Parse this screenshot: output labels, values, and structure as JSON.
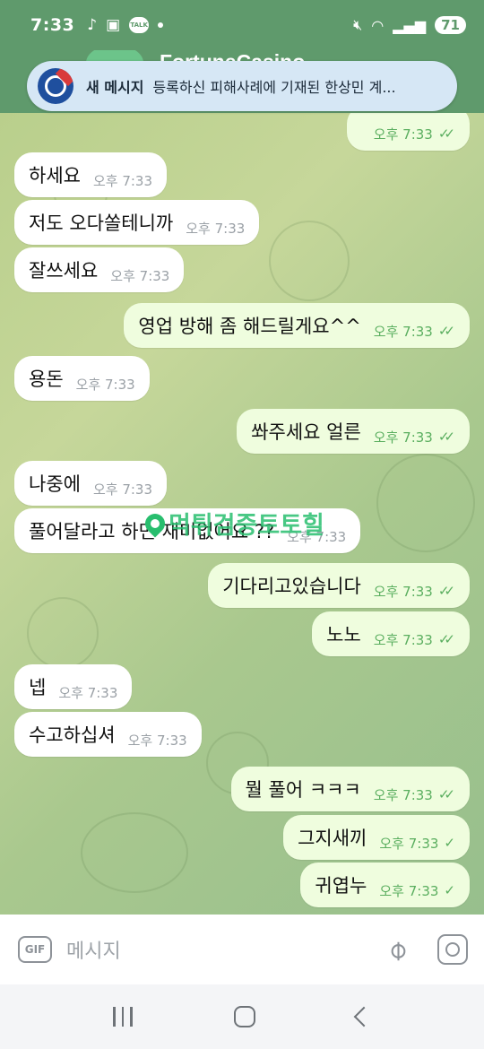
{
  "status": {
    "time": "7:33",
    "talk_label": "TALK",
    "battery": "71"
  },
  "header": {
    "title": "FortuneCasino"
  },
  "notification": {
    "title": "새 메시지",
    "text": "등록하신 피해사례에 기재된 한상민 계..."
  },
  "messages": [
    {
      "text": "",
      "time": "오후 7:33",
      "direction": "out",
      "status": "read"
    },
    {
      "text": "하세요",
      "time": "오후 7:33",
      "direction": "in"
    },
    {
      "text": "저도 오다쏠테니까",
      "time": "오후 7:33",
      "direction": "in"
    },
    {
      "text": "잘쓰세요",
      "time": "오후 7:33",
      "direction": "in"
    },
    {
      "text": "영업 방해 좀 해드릴게요^^",
      "time": "오후 7:33",
      "direction": "out",
      "status": "read"
    },
    {
      "text": "용돈",
      "time": "오후 7:33",
      "direction": "in"
    },
    {
      "text": "쏴주세요 얼른",
      "time": "오후 7:33",
      "direction": "out",
      "status": "read"
    },
    {
      "text": "나중에",
      "time": "오후 7:33",
      "direction": "in"
    },
    {
      "text": "풀어달라고 하면 재미없어요 ??",
      "time": "오후 7:33",
      "direction": "in"
    },
    {
      "text": "기다리고있습니다",
      "time": "오후 7:33",
      "direction": "out",
      "status": "read"
    },
    {
      "text": "노노",
      "time": "오후 7:33",
      "direction": "out",
      "status": "read"
    },
    {
      "text": "넵",
      "time": "오후 7:33",
      "direction": "in"
    },
    {
      "text": "수고하십셔",
      "time": "오후 7:33",
      "direction": "in"
    },
    {
      "text": "뭘 풀어 ㅋㅋㅋ",
      "time": "오후 7:33",
      "direction": "out",
      "status": "read"
    },
    {
      "text": "그지새끼",
      "time": "오후 7:33",
      "direction": "out",
      "status": "sent"
    },
    {
      "text": "귀엽누",
      "time": "오후 7:33",
      "direction": "out",
      "status": "sent"
    }
  ],
  "watermark": "먹튀검증토토힐",
  "input": {
    "gif_label": "GIF",
    "placeholder": "메시지"
  },
  "icons": {
    "read": "double-check-icon",
    "sent": "single-check-icon",
    "attach": "paperclip-icon",
    "camera": "camera-icon"
  },
  "colors": {
    "header": "#5f9a6c",
    "outgoing_bubble": "#effdde",
    "incoming_bubble": "#ffffff",
    "check": "#5aae5f"
  }
}
